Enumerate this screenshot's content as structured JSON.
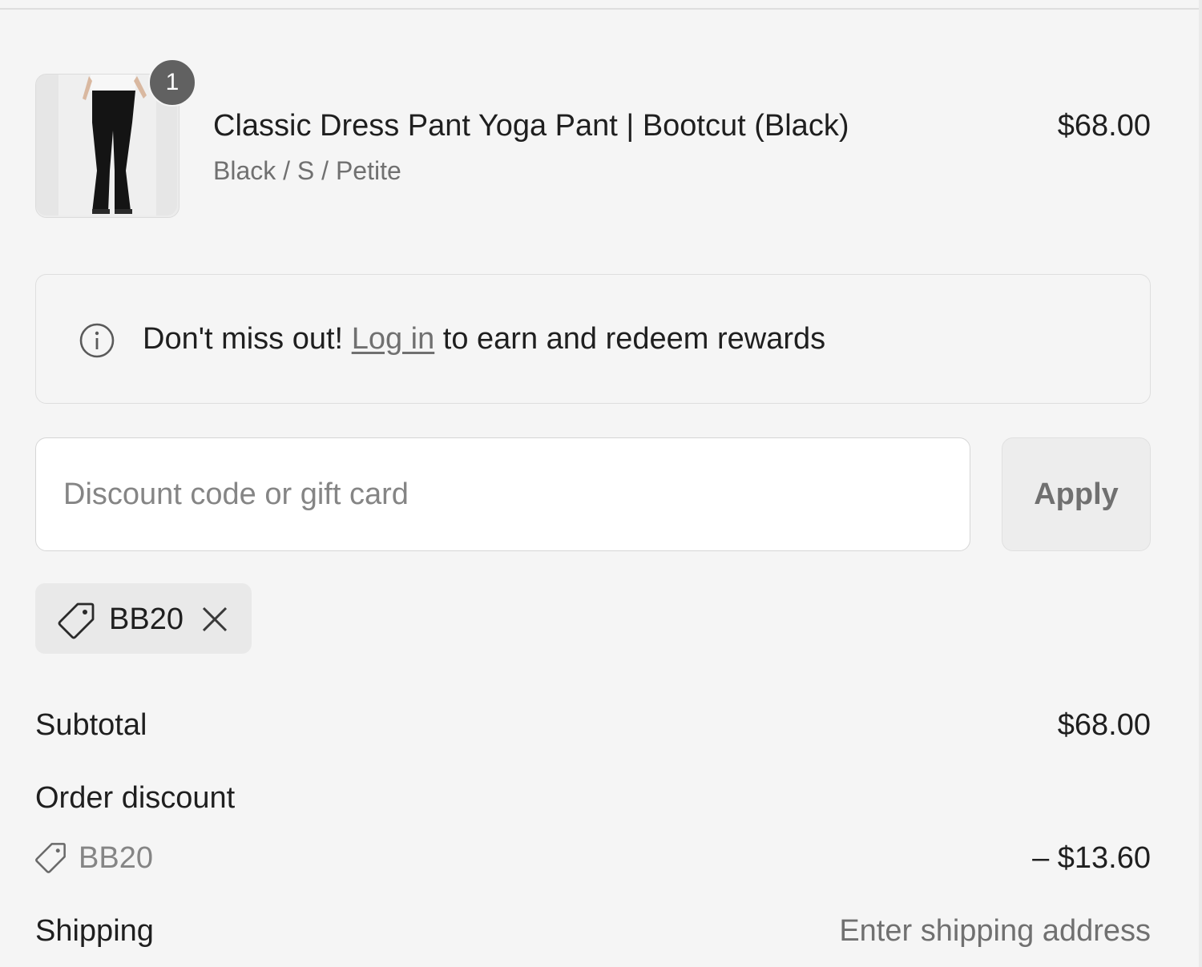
{
  "product": {
    "quantity": "1",
    "name": "Classic Dress Pant Yoga Pant | Bootcut (Black)",
    "variant": "Black / S / Petite",
    "price": "$68.00"
  },
  "rewards": {
    "prefix": "Don't miss out! ",
    "link": "Log in",
    "suffix": " to earn and redeem rewards"
  },
  "discount": {
    "placeholder": "Discount code or gift card",
    "apply_label": "Apply",
    "applied_code": "BB20"
  },
  "summary": {
    "subtotal_label": "Subtotal",
    "subtotal_value": "$68.00",
    "order_discount_label": "Order discount",
    "discount_code": "BB20",
    "discount_value": "– $13.60",
    "shipping_label": "Shipping",
    "shipping_value": "Enter shipping address"
  },
  "icons": {
    "info": "info-icon",
    "tag": "tag-icon",
    "close": "close-icon"
  }
}
